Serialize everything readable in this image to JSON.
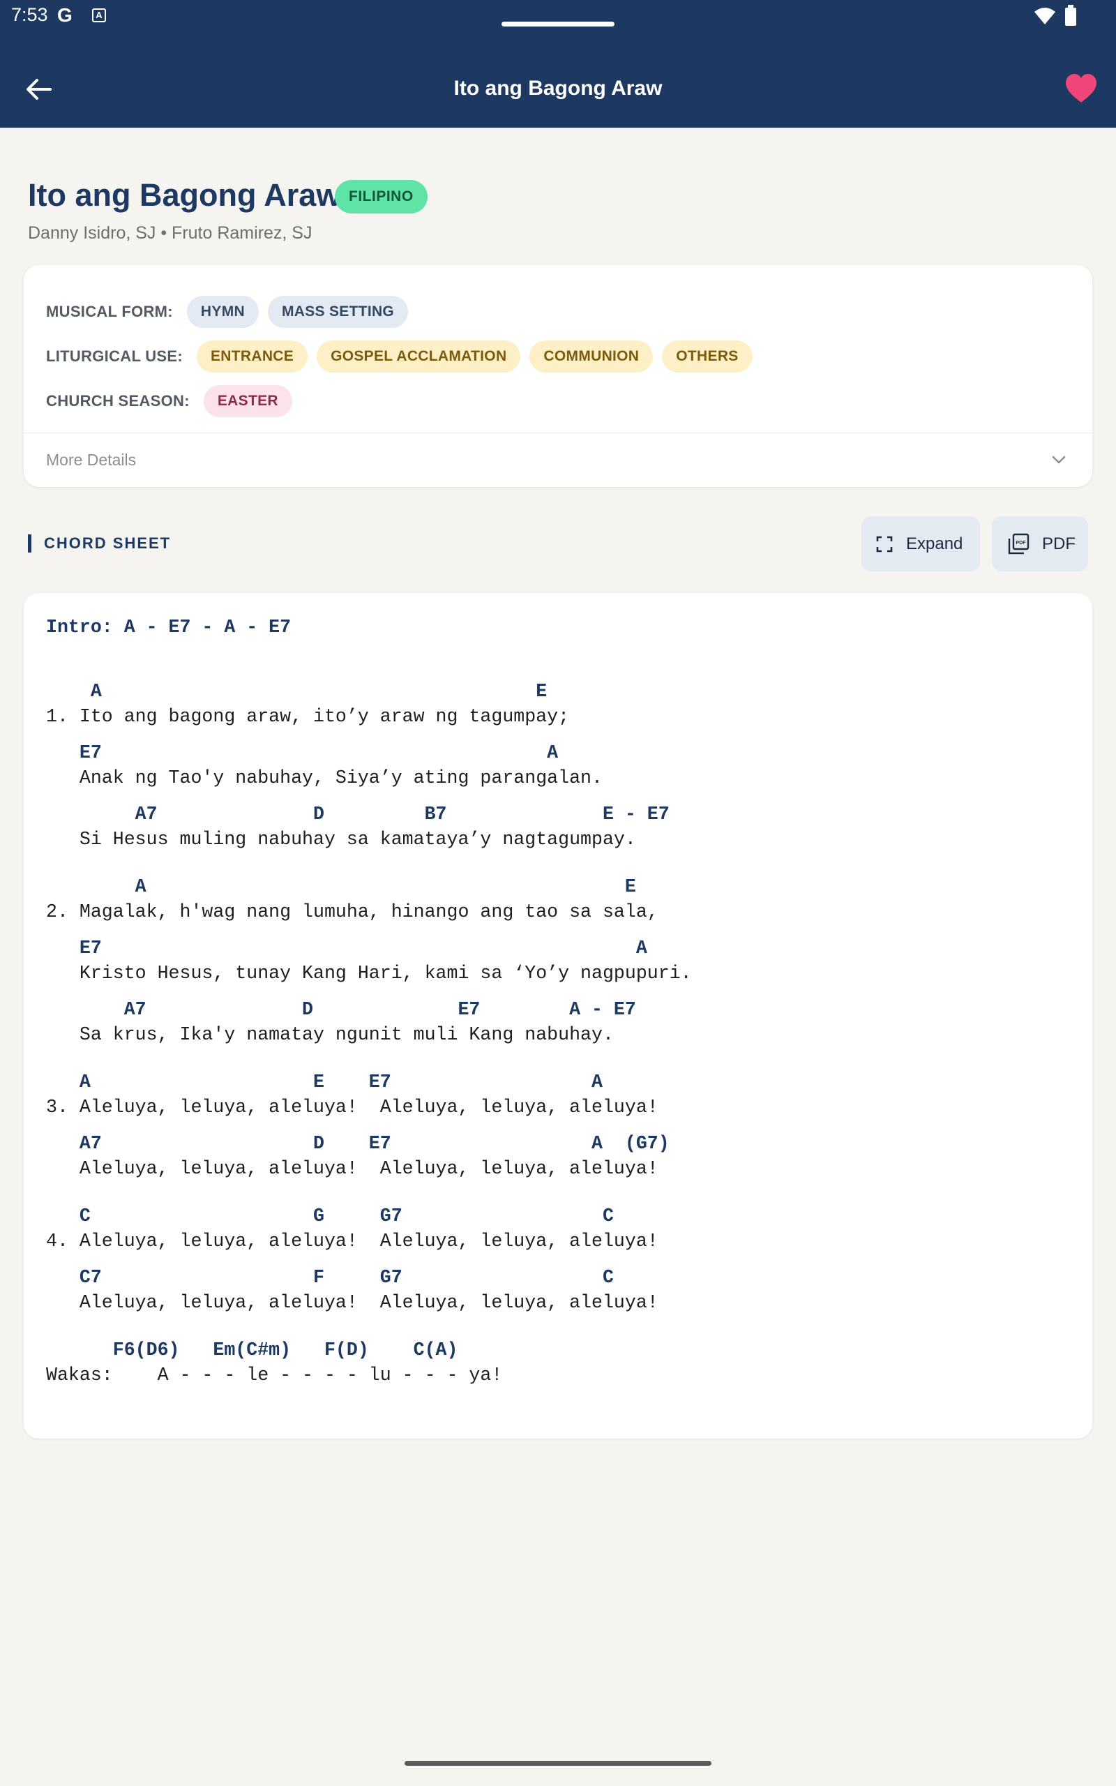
{
  "status_bar": {
    "time": "7:53",
    "g_icon": "G",
    "a_icon": "A"
  },
  "app_bar": {
    "title": "Ito ang Bagong Araw",
    "back_icon": "arrow-left-icon",
    "favorite_icon": "heart-icon",
    "favorite_color": "#f0467a"
  },
  "song": {
    "title": "Ito ang Bagong Araw",
    "language": "FILIPINO",
    "composers": "Danny Isidro, SJ • Fruto Ramirez, SJ"
  },
  "details": {
    "musical_form_label": "MUSICAL FORM:",
    "musical_form": [
      "HYMN",
      "MASS SETTING"
    ],
    "liturgical_use_label": "LITURGICAL USE:",
    "liturgical_use": [
      "ENTRANCE",
      "GOSPEL ACCLAMATION",
      "COMMUNION",
      "OTHERS"
    ],
    "church_season_label": "CHURCH SEASON:",
    "church_season": [
      "EASTER"
    ],
    "more_details": "More Details"
  },
  "chord_sheet": {
    "title": "CHORD SHEET",
    "expand_label": "Expand",
    "pdf_label": "PDF",
    "lines": [
      {
        "type": "chord",
        "text": "Intro: A - E7 - A - E7"
      },
      {
        "type": "chord",
        "text": "    A                                       E"
      },
      {
        "type": "lyric",
        "text": "1. Ito ang bagong araw, ito’y araw ng tagumpay;"
      },
      {
        "type": "chord",
        "text": "   E7                                        A"
      },
      {
        "type": "lyric",
        "text": "   Anak ng Tao'y nabuhay, Siya’y ating parangalan."
      },
      {
        "type": "chord",
        "text": "        A7              D         B7              E - E7"
      },
      {
        "type": "lyric",
        "text": "   Si Hesus muling nabuhay sa kamataya’y nagtagumpay."
      },
      {
        "type": "chord",
        "text": "        A                                           E"
      },
      {
        "type": "lyric",
        "text": "2. Magalak, h'wag nang lumuha, hinango ang tao sa sala,"
      },
      {
        "type": "chord",
        "text": "   E7                                                A"
      },
      {
        "type": "lyric",
        "text": "   Kristo Hesus, tunay Kang Hari, kami sa ‘Yo’y nagpupuri."
      },
      {
        "type": "chord",
        "text": "       A7              D             E7        A - E7"
      },
      {
        "type": "lyric",
        "text": "   Sa krus, Ika'y namatay ngunit muli Kang nabuhay."
      },
      {
        "type": "chord",
        "text": "   A                    E    E7                  A"
      },
      {
        "type": "lyric",
        "text": "3. Aleluya, leluya, aleluya!  Aleluya, leluya, aleluya!"
      },
      {
        "type": "chord",
        "text": "   A7                   D    E7                  A  (G7)"
      },
      {
        "type": "lyric",
        "text": "   Aleluya, leluya, aleluya!  Aleluya, leluya, aleluya!"
      },
      {
        "type": "chord",
        "text": "   C                    G     G7                  C"
      },
      {
        "type": "lyric",
        "text": "4. Aleluya, leluya, aleluya!  Aleluya, leluya, aleluya!"
      },
      {
        "type": "chord",
        "text": "   C7                   F     G7                  C"
      },
      {
        "type": "lyric",
        "text": "   Aleluya, leluya, aleluya!  Aleluya, leluya, aleluya!"
      },
      {
        "type": "chord",
        "text": "      F6(D6)   Em(C#m)   F(D)    C(A)"
      },
      {
        "type": "lyric",
        "text": "Wakas:    A - - - le - - - - lu - - - ya!"
      }
    ]
  }
}
